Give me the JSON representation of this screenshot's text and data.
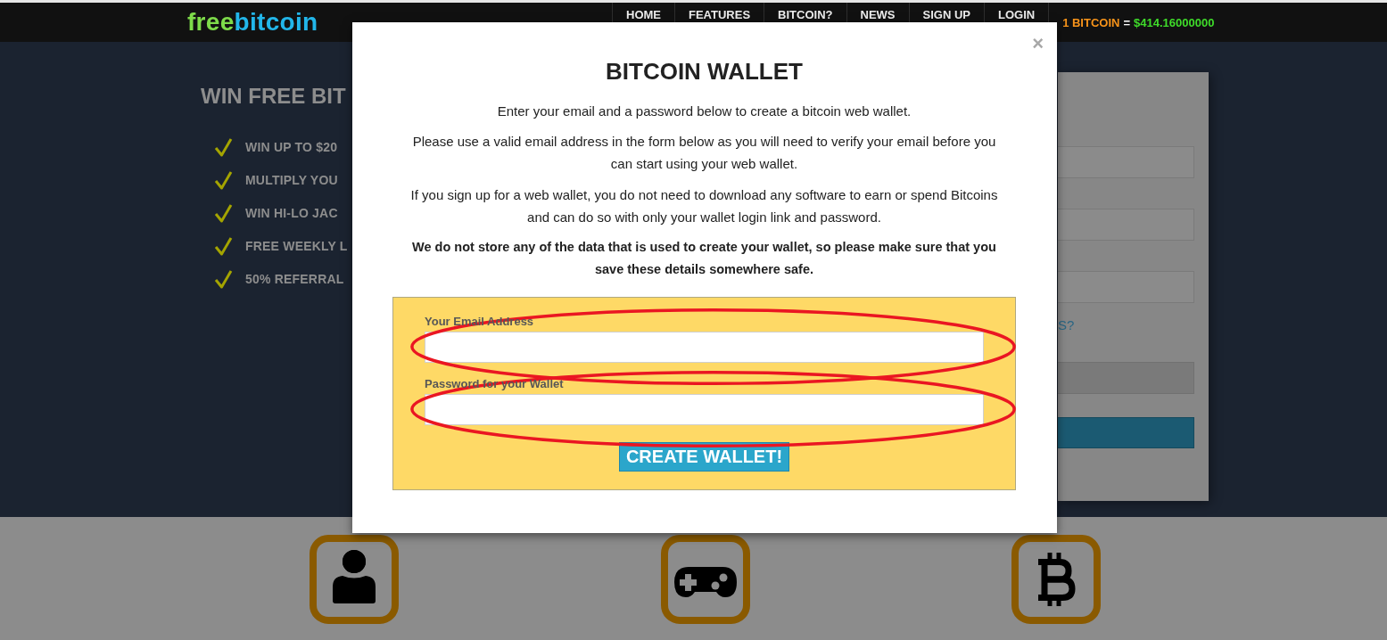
{
  "nav": {
    "logo": {
      "first": "free",
      "second": "bitcoin"
    },
    "items": [
      {
        "label": "HOME"
      },
      {
        "label": "FEATURES"
      },
      {
        "label": "BITCOIN?"
      },
      {
        "label": "NEWS"
      },
      {
        "label": "SIGN UP"
      },
      {
        "label": "LOGIN"
      }
    ],
    "rate": {
      "label": "1 BITCOIN",
      "equals": "=",
      "value": "$414.16000000"
    }
  },
  "hero": {
    "headline": "WIN FREE BIT",
    "features": [
      "WIN UP TO $20",
      "MULTIPLY YOU",
      "WIN HI-LO JAC",
      "FREE WEEKLY L",
      "50% REFERRAL"
    ]
  },
  "side_card": {
    "items": [
      {
        "kind": "field"
      },
      {
        "kind": "field"
      },
      {
        "kind": "field"
      },
      {
        "kind": "link",
        "text": "S?"
      },
      {
        "kind": "disabled_field"
      },
      {
        "kind": "button"
      }
    ]
  },
  "modal": {
    "close": "×",
    "title": "BITCOIN WALLET",
    "paragraphs": [
      {
        "text": "Enter your email and a password below to create a bitcoin web wallet.",
        "bold": false
      },
      {
        "text": "Please use a valid email address in the form below as you will need to verify your email before you can start using your web wallet.",
        "bold": false
      },
      {
        "text": "If you sign up for a web wallet, you do not need to download any software to earn or spend Bitcoins and can do so with only your wallet login link and password.",
        "bold": false
      },
      {
        "text": "We do not store any of the data that is used to create your wallet, so please make sure that you save these details somewhere safe.",
        "bold": true
      }
    ],
    "form": {
      "fields": [
        {
          "label": "Your Email Address",
          "circled": true
        },
        {
          "label": "Password for your Wallet",
          "circled": true
        }
      ],
      "submit": "CREATE WALLET!"
    }
  },
  "features": {
    "icons": [
      {
        "kind": "user"
      },
      {
        "kind": "gamepad"
      },
      {
        "kind": "bitcoin"
      }
    ]
  }
}
